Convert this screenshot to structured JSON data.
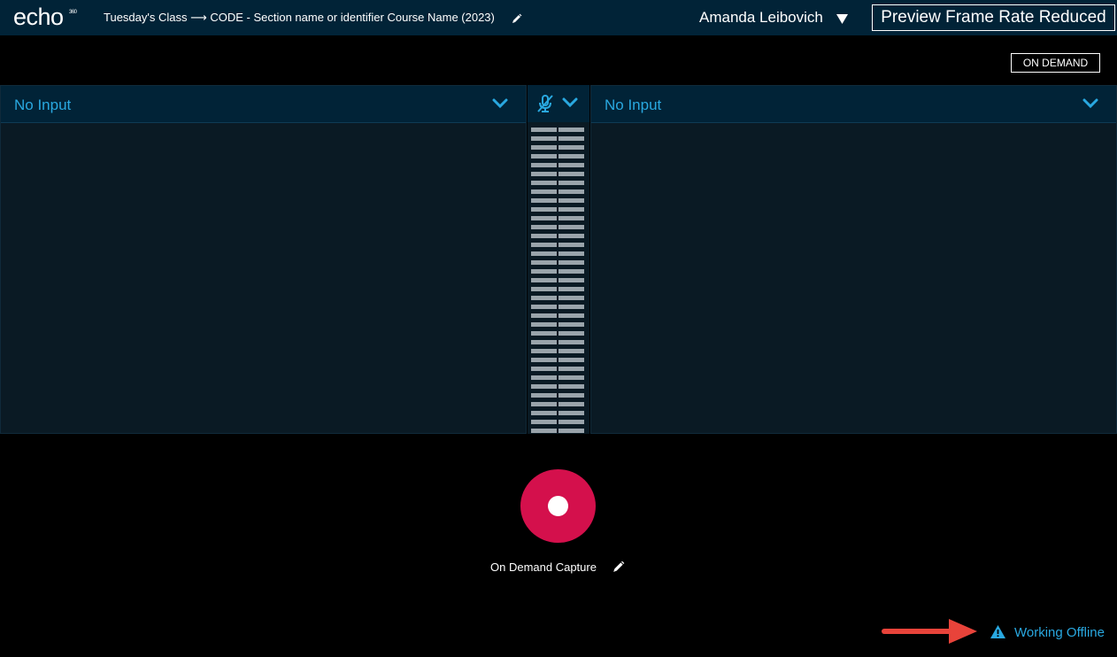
{
  "header": {
    "logo_text": "echo",
    "logo_superscript": "360",
    "course_title": "Tuesday's Class ⟶ CODE - Section name or identifier Course Name (2023)",
    "user_name": "Amanda Leibovich",
    "preview_status": "Preview Frame Rate Reduced"
  },
  "mode": "ON DEMAND",
  "inputs": {
    "left": {
      "label": "No Input"
    },
    "right": {
      "label": "No Input"
    }
  },
  "audio": {
    "meter_segments": 35
  },
  "capture": {
    "label": "On Demand Capture"
  },
  "status": {
    "label": "Working Offline"
  },
  "colors": {
    "topbar": "#012337",
    "accent": "#29a8e0",
    "record": "#d4104c",
    "annotation_arrow": "#e8433a"
  }
}
